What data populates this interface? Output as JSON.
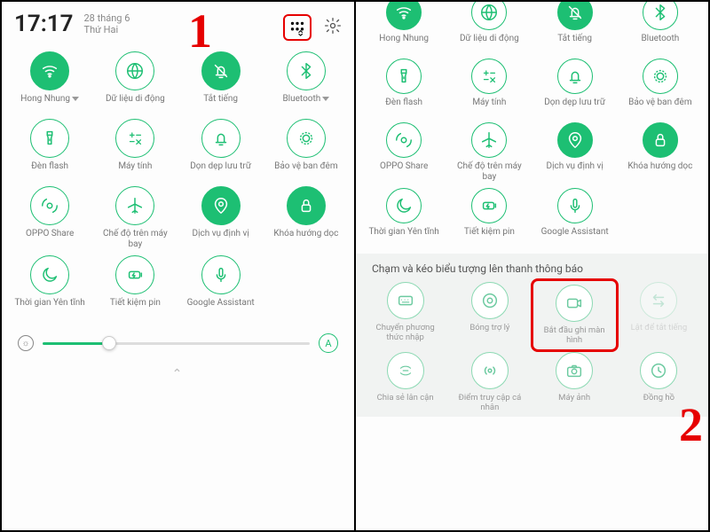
{
  "header": {
    "time": "17:17",
    "date_line1": "28 tháng 6",
    "date_line2": "Thứ Hai"
  },
  "callouts": {
    "one": "1",
    "two": "2"
  },
  "tiles": {
    "wifi": "Hong Nhung",
    "data": "Dữ liệu di động",
    "mute": "Tắt tiếng",
    "bt": "Bluetooth",
    "flash": "Đèn flash",
    "calc": "Máy tính",
    "clean": "Dọn dẹp lưu trữ",
    "night": "Bảo vệ ban đêm",
    "share": "OPPO Share",
    "plane": "Chế độ trên máy bay",
    "loc": "Dịch vụ định vị",
    "lock": "Khóa hướng dọc",
    "zen": "Thời gian Yên tĩnh",
    "battery": "Tiết kiệm pin",
    "assist": "Google Assistant"
  },
  "edit": {
    "title": "Chạm và kéo biểu tượng lên thanh thông báo",
    "input": "Chuyển phương thức nhập",
    "bubble": "Bóng trợ lý",
    "record": "Bắt đầu ghi màn hình",
    "hidden": "Lật để tắt tiếng",
    "nearby": "Chia sẻ lân cận",
    "hotspot": "Điểm truy cập cá nhân",
    "camera": "Máy ảnh",
    "clock": "Đồng hồ"
  },
  "auto": "A"
}
